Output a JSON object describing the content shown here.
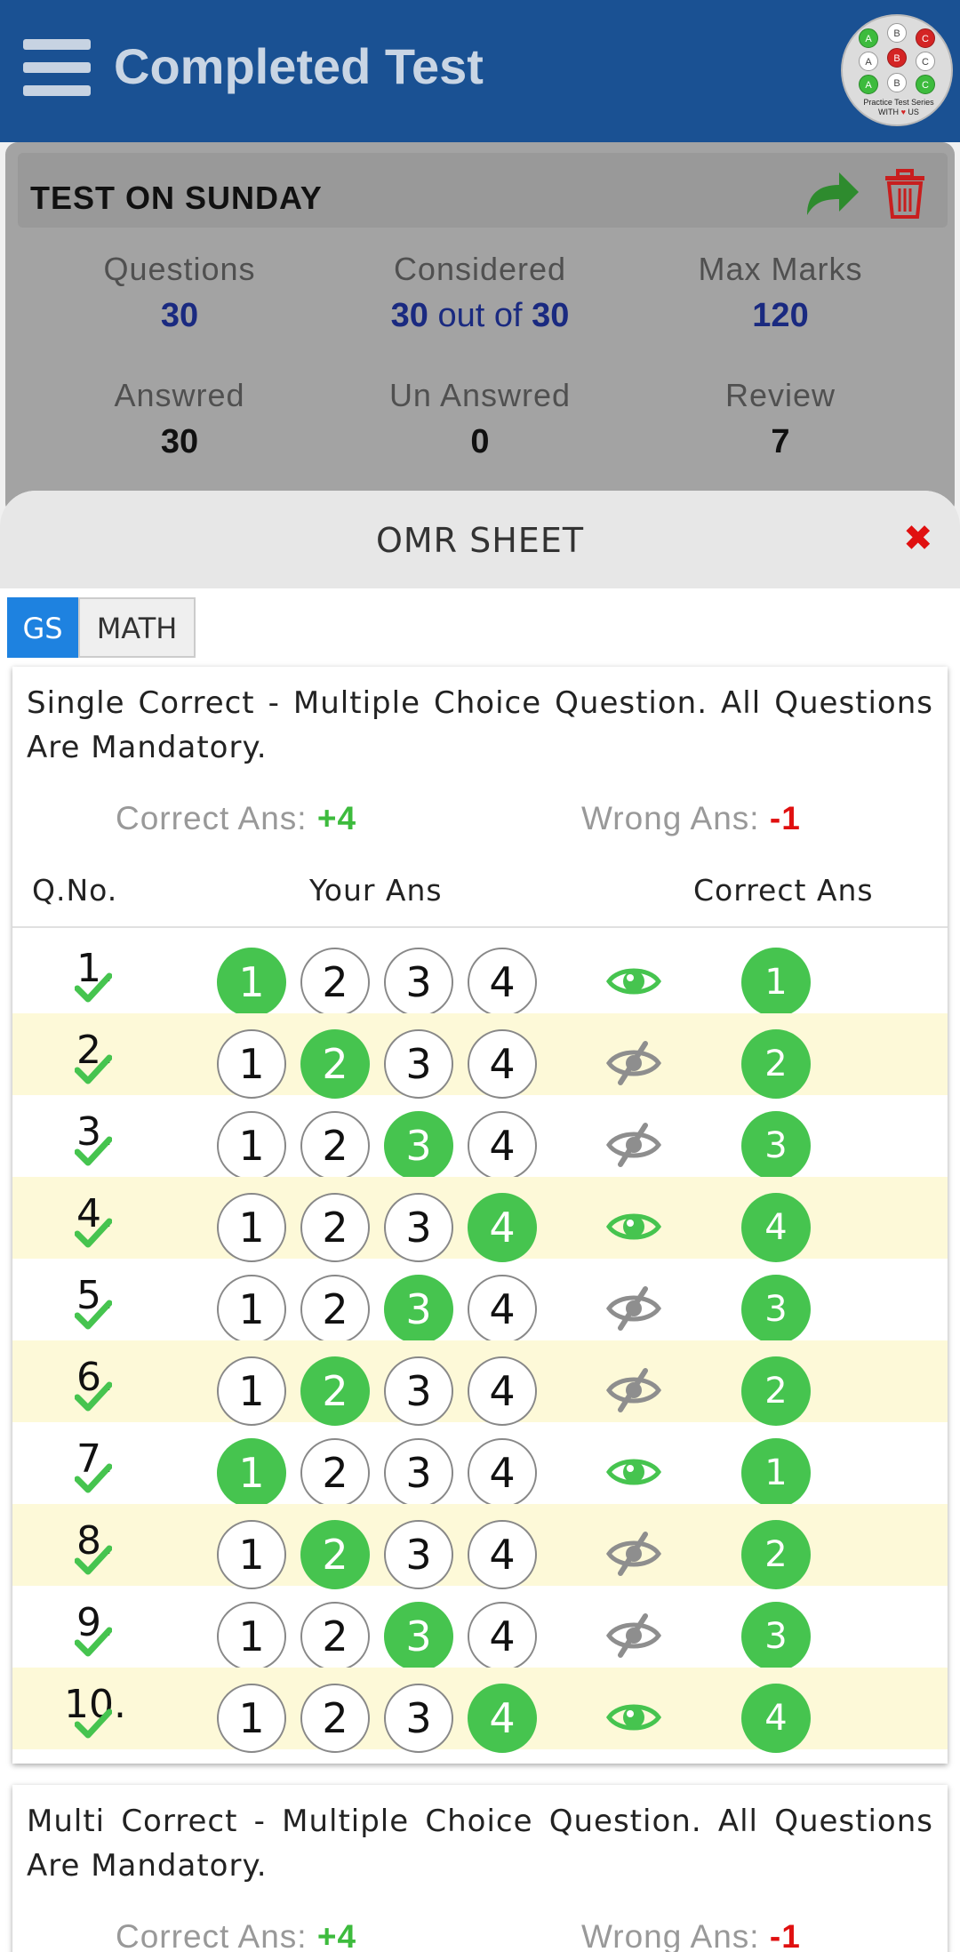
{
  "app_bar": {
    "title": "Completed Test",
    "logo": {
      "grid": [
        [
          "A",
          "B",
          "C"
        ],
        [
          "A",
          "B",
          "C"
        ],
        [
          "A",
          "B",
          "C"
        ]
      ],
      "caption_line1": "Practice Test Series",
      "caption_line2a": "WITH",
      "caption_line2b": "US"
    }
  },
  "test_card": {
    "name": "TEST ON SUNDAY",
    "stats": {
      "questions_label": "Questions",
      "questions_value": "30",
      "considered_label": "Considered",
      "considered_num": "30",
      "considered_mid": "out of",
      "considered_total": "30",
      "max_marks_label": "Max Marks",
      "max_marks_value": "120",
      "answered_label": "Answred",
      "answered_value": "30",
      "unanswered_label": "Un Answred",
      "unanswered_value": "0",
      "review_label": "Review",
      "review_value": "7"
    }
  },
  "omr": {
    "title": "OMR SHEET",
    "close_glyph": "✖",
    "tabs": [
      {
        "label": "GS",
        "active": true
      },
      {
        "label": "MATH",
        "active": false
      }
    ],
    "sections": [
      {
        "description": "Single Correct - Multiple Choice Question. All Questions Are Mandatory.",
        "correct_label": "Correct Ans:",
        "correct_value": "+4",
        "wrong_label": "Wrong Ans:",
        "wrong_value": "-1",
        "col_qno": "Q.No.",
        "col_your": "Your Ans",
        "col_correct": "Correct Ans"
      },
      {
        "description": "Multi Correct - Multiple Choice Question. All Questions Are Mandatory.",
        "correct_label": "Correct Ans:",
        "correct_value": "+4",
        "wrong_label": "Wrong Ans:",
        "wrong_value": "-1"
      }
    ],
    "options": [
      "1",
      "2",
      "3",
      "4"
    ],
    "rows": [
      {
        "qno": "1.",
        "selected": "1",
        "correct": "1",
        "review": false
      },
      {
        "qno": "2.",
        "selected": "2",
        "correct": "2",
        "review": true
      },
      {
        "qno": "3.",
        "selected": "3",
        "correct": "3",
        "review": true
      },
      {
        "qno": "4.",
        "selected": "4",
        "correct": "4",
        "review": false
      },
      {
        "qno": "5.",
        "selected": "3",
        "correct": "3",
        "review": true
      },
      {
        "qno": "6.",
        "selected": "2",
        "correct": "2",
        "review": true
      },
      {
        "qno": "7.",
        "selected": "1",
        "correct": "1",
        "review": false
      },
      {
        "qno": "8.",
        "selected": "2",
        "correct": "2",
        "review": true
      },
      {
        "qno": "9.",
        "selected": "3",
        "correct": "3",
        "review": true
      },
      {
        "qno": "10.",
        "selected": "4",
        "correct": "4",
        "review": false
      }
    ]
  },
  "colors": {
    "app_bar": "#1a5193",
    "accent_green": "#46c44f",
    "danger_red": "#e01010",
    "tab_active": "#1e82e0",
    "row_alt": "#fdf9d8",
    "stat_blue": "#1a2a80"
  },
  "icons": [
    "menu-icon",
    "logo",
    "share-icon",
    "trash-icon",
    "close-icon",
    "eye-icon",
    "eye-slash-icon",
    "check-icon"
  ]
}
